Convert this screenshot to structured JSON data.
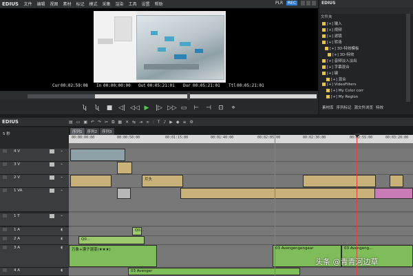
{
  "player": {
    "brand": "EDIUS",
    "menu": [
      "文件",
      "编辑",
      "视图",
      "素材",
      "标记",
      "模式",
      "采集",
      "渲染",
      "工具",
      "设置",
      "帮助"
    ],
    "plr": "PLR",
    "rec": "REC",
    "timecodes": {
      "cur_label": "Cur",
      "cur": "00:02:59:08",
      "in_label": "In",
      "in": "00:00:00:00",
      "out_label": "Out",
      "out": "00:05:21:01",
      "dur_label": "Dur",
      "dur": "00:05:21:01",
      "ttl_label": "Ttl",
      "ttl": "00:05:21:01"
    },
    "controls": [
      "ʮ",
      "ʯ",
      "■",
      "◁|",
      "◁◁",
      "▶",
      "|▷",
      "▷▷",
      "▭",
      "⊢",
      "⊣",
      "⊡",
      "⌖"
    ]
  },
  "bin": {
    "title": "EDIUS",
    "header": "文件夹",
    "tree": [
      {
        "label": "[+] 输入",
        "indent": 0
      },
      {
        "label": "[+] 视频",
        "indent": 0
      },
      {
        "label": "[+] 滤镜",
        "indent": 0
      },
      {
        "label": "[+] 转场",
        "indent": 0
      },
      {
        "label": "[+] 3D-特效模板",
        "indent": 4
      },
      {
        "label": "[+] 3D-特效",
        "indent": 8
      },
      {
        "label": "[+] 音频淡入淡出",
        "indent": 0
      },
      {
        "label": "[+] 字幕混合",
        "indent": 0
      },
      {
        "label": "[+] 键",
        "indent": 0
      },
      {
        "label": "[+] 混合",
        "indent": 6
      },
      {
        "label": "[+] VideoFilters",
        "indent": 0
      },
      {
        "label": "[+] My Color corr",
        "indent": 6
      },
      {
        "label": "[+] My Region",
        "indent": 6
      }
    ],
    "tabs": [
      "素材库",
      "序列标记",
      "源文件浏览",
      "特效"
    ]
  },
  "timeline": {
    "brand": "EDIUS",
    "seq_tabs": [
      "序列1",
      "序列2",
      "序列3"
    ],
    "ruler": [
      "00:00:00:00",
      "00:00:50:00",
      "00:01:15:00",
      "00:01:40:00",
      "00:02:05:00",
      "00:02:30:00",
      "00:02:55:00",
      "00:03:20:00"
    ],
    "tracks": [
      {
        "name": "4 V",
        "type": "v"
      },
      {
        "name": "3 V",
        "type": "v"
      },
      {
        "name": "2 V",
        "type": "v"
      },
      {
        "name": "1 VA",
        "type": "va"
      },
      {
        "name": "1 T",
        "type": "t"
      },
      {
        "name": "1 A",
        "type": "a"
      },
      {
        "name": "2 A",
        "type": "a"
      },
      {
        "name": "3 A",
        "type": "a"
      },
      {
        "name": "4 A",
        "type": "a"
      }
    ],
    "clip_labels": {
      "c1": "片头",
      "c2": "Q0...",
      "c3": "Q0...",
      "c4": "万象+漂子混变(★★★)",
      "c5": "03 Avengengengear",
      "c6": "03 Avengeng...",
      "c7": "03 Avenger"
    },
    "zoom": "5 秒"
  },
  "watermark": "头条 @青青河边草"
}
